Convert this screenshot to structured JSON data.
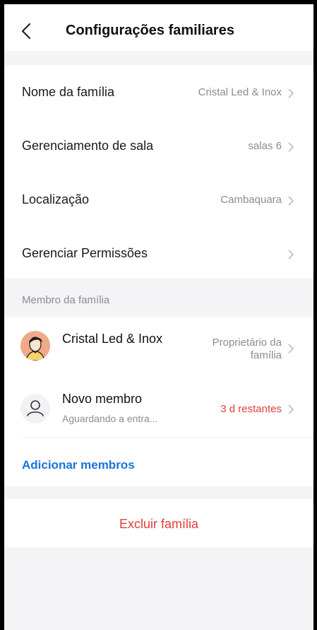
{
  "header": {
    "title": "Configurações familiares",
    "back_icon": "chevron-left-icon"
  },
  "settings": {
    "items": [
      {
        "label": "Nome da família",
        "value": "Cristal Led & Inox"
      },
      {
        "label": "Gerenciamento de sala",
        "value": "salas 6"
      },
      {
        "label": "Localização",
        "value": "Cambaquara"
      },
      {
        "label": "Gerenciar Permissões",
        "value": ""
      }
    ]
  },
  "members": {
    "section_label": "Membro da família",
    "list": [
      {
        "name": "Cristal Led & Inox",
        "role_line1": "Proprietário da",
        "role_line2": "família",
        "avatar_icon": "user-avatar-icon"
      },
      {
        "name": "Novo membro",
        "subtitle": "Aguardando a entra...",
        "status": "3 d restantes",
        "avatar_icon": "user-outline-icon"
      }
    ],
    "add_label": "Adicionar membros"
  },
  "delete_label": "Excluir família",
  "colors": {
    "accent_blue": "#1a73d9",
    "danger_red": "#e0403a",
    "muted_text": "#8c8c8c",
    "background": "#f4f4f6"
  }
}
